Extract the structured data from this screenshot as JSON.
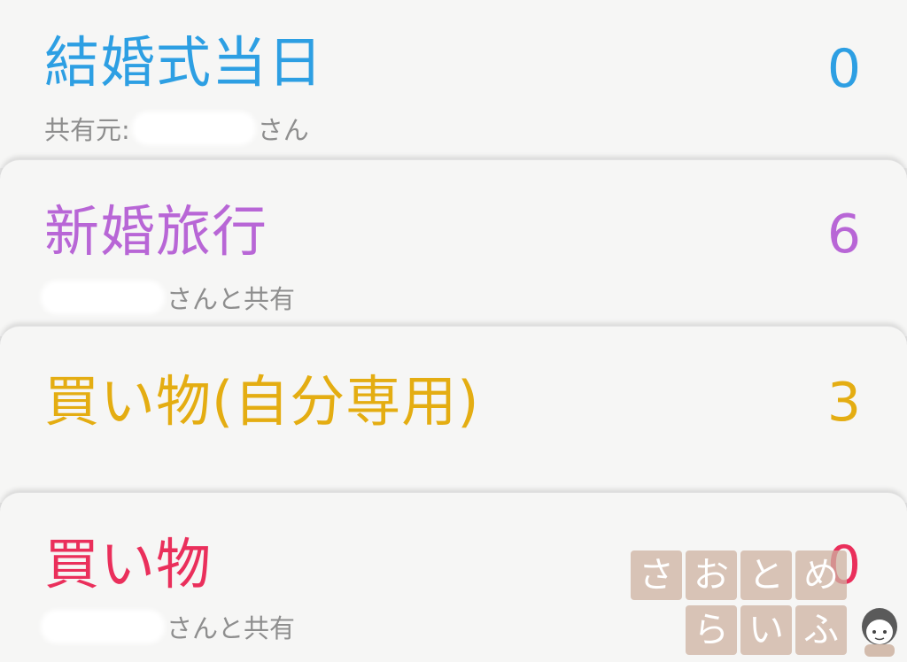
{
  "lists": [
    {
      "title": "結婚式当日",
      "count": "0",
      "subtitle_prefix": "共有元:",
      "subtitle_suffix": "さん",
      "color": "#2d9fe3"
    },
    {
      "title": "新婚旅行",
      "count": "6",
      "subtitle_prefix": "",
      "subtitle_suffix": "さんと共有",
      "color": "#b866d6"
    },
    {
      "title": "買い物(自分専用)",
      "count": "3",
      "subtitle_prefix": "",
      "subtitle_suffix": "",
      "color": "#e4ad12"
    },
    {
      "title": "買い物",
      "count": "0",
      "subtitle_prefix": "",
      "subtitle_suffix": "さんと共有",
      "color": "#ea2f5b"
    }
  ],
  "watermark": {
    "row1": [
      "さ",
      "お",
      "と",
      "め"
    ],
    "row2": [
      "ら",
      "い",
      "ふ"
    ],
    "color": "#cdb2a0"
  }
}
